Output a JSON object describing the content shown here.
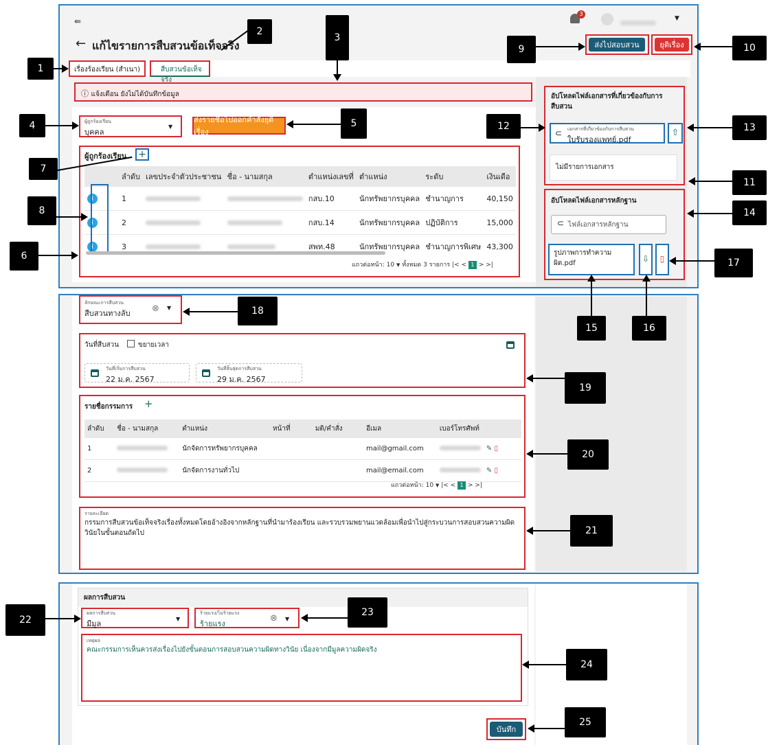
{
  "header": {
    "collapse_icon": "collapse-sidebar-icon",
    "title": "แก้ไขรายการสืบสวนข้อเท็จจริง",
    "notification_count": "3",
    "send_button": "ส่งไปสอบสวน",
    "stop_button": "ยุติเรื่อง"
  },
  "tabs": [
    "เรื่องร้องเรียน (สำเนา)",
    "สืบสวนข้อเท็จจริง"
  ],
  "alert": "แจ้งเตือน ยังไม่ได้บันทึกข้อมูล",
  "complainant_select": {
    "label": "ผู้ถูกร้องเรียน",
    "value": "บุคคล"
  },
  "orange_button": "ส่งรายชื่อไปออกคำสั่งยุติเรื่อง",
  "accused_table": {
    "title": "ผู้ถูกร้องเรียน",
    "headers": [
      "ลำดับ",
      "เลขประจำตัวประชาชน",
      "ชื่อ - นามสกุล",
      "ตำแหน่งเลขที่",
      "ตำแหน่ง",
      "ระดับ",
      "เงินเดือ"
    ],
    "rows": [
      {
        "no": "1",
        "pos_no": "กสบ.10",
        "position": "นักทรัพยากรบุคคล",
        "level": "ชำนาญการ",
        "salary": "40,150"
      },
      {
        "no": "2",
        "pos_no": "กสบ.14",
        "position": "นักทรัพยากรบุคคล",
        "level": "ปฏิบัติการ",
        "salary": "15,000"
      },
      {
        "no": "3",
        "pos_no": "สพท.48",
        "position": "นักทรัพยากรบุคคล",
        "level": "ชำนาญการพิเศษ",
        "salary": "43,300"
      }
    ],
    "pagination": {
      "per_page_label": "แถวต่อหน้า:",
      "per_page": "10",
      "total": "ทั้งหมด 3 รายการ",
      "page": "1"
    }
  },
  "upload_related": {
    "title": "อัปโหลดไฟล์เอกสารที่เกี่ยวข้องกับการสืบสวน",
    "file_label": "เอกสารที่เกี่ยวข้องกับการสืบสวน",
    "file_name": "ใบรับรองแพทย์.pdf",
    "empty_text": "ไม่มีรายการเอกสาร"
  },
  "upload_evidence": {
    "title": "อัปโหลดไฟล์เอกสารหลักฐาน",
    "placeholder": "ไฟล์เอกสารหลักฐาน",
    "file_name_line1": "รูปภาพการทำความ",
    "file_name_line2": "ผิด.pdf"
  },
  "investigation_type": {
    "label": "ลักษณะการสืบสวน",
    "value": "สืบสวนทางลับ"
  },
  "dates": {
    "title": "วันที่สืบสวน",
    "extend_label": "ขยายเวลา",
    "start_label": "วันที่เริ่มการสืบสวน",
    "start_value": "22 ม.ค. 2567",
    "end_label": "วันที่สิ้นสุดการสืบสวน",
    "end_value": "29 ม.ค. 2567"
  },
  "committee": {
    "title": "รายชื่อกรรมการ",
    "headers": [
      "ลำดับ",
      "ชื่อ - นามสกุล",
      "ตำแหน่ง",
      "หน้าที่",
      "มติ/คำสั่ง",
      "อีเมล",
      "เบอร์โทรศัพท์"
    ],
    "rows": [
      {
        "no": "1",
        "position": "นักจัดการทรัพยากรบุคคล",
        "email": "mail@gmail.com"
      },
      {
        "no": "2",
        "position": "นักจัดการงานทั่วไป",
        "email": "mail@email.com"
      }
    ],
    "pagination": {
      "per_page_label": "แถวต่อหน้า:",
      "per_page": "10",
      "page": "1"
    }
  },
  "report": {
    "label": "รายละเอียด",
    "text": "กรรมการสืบสวนข้อเท็จจริงเรื่องทั้งหมดโดยอ้างอิงจากหลักฐานที่นำมาร้องเรียน และรวบรวมพยานแวดล้อมเพื่อนำไปสู่กระบวนการสอบสวนความผิดวินัยในขั้นตอนถัดไป"
  },
  "result": {
    "title": "ผลการสืบสวน",
    "outcome_label": "ผลการสืบสวน",
    "outcome_value": "มีมูล",
    "severity_label": "ร้ายแรง/ไม่ร้ายแรง",
    "severity_value": "ร้ายแรง",
    "reason_label": "เหตุผล",
    "reason_text": "คณะกรรมการเห็นควรส่งเรื่องไปยังขั้นตอนการสอบสวนความผิดทางวินัย เนื่องจากมีมูลความผิดจริง",
    "save_button": "บันทึก"
  },
  "callouts": [
    "1",
    "2",
    "3",
    "4",
    "5",
    "6",
    "7",
    "8",
    "9",
    "10",
    "11",
    "12",
    "13",
    "14",
    "15",
    "16",
    "17",
    "18",
    "19",
    "20",
    "21",
    "22",
    "23",
    "24",
    "25"
  ],
  "colors": {
    "accent": "#1b5b76",
    "danger": "#d33333",
    "orange": "#f4931f",
    "highlight_red": "#d9262e",
    "highlight_blue": "#1f6fb2"
  }
}
